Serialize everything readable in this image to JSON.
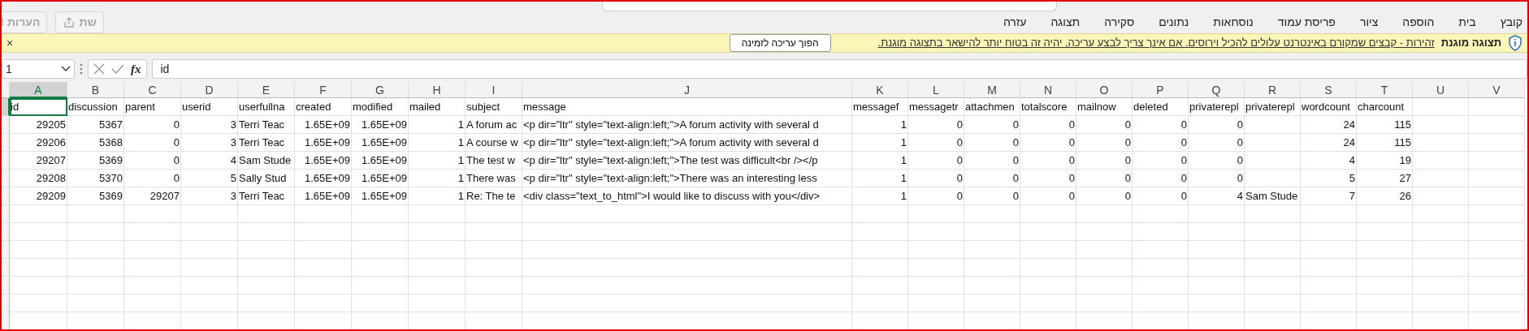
{
  "ribbon": {
    "tabs": [
      {
        "label": "קובץ",
        "selected": false
      },
      {
        "label": "בית",
        "selected": false
      },
      {
        "label": "הוספה",
        "selected": false
      },
      {
        "label": "ציור",
        "selected": false
      },
      {
        "label": "פריסת עמוד",
        "selected": false
      },
      {
        "label": "נוסחאות",
        "selected": false
      },
      {
        "label": "נתונים",
        "selected": false
      },
      {
        "label": "סקירה",
        "selected": false
      },
      {
        "label": "תצוגה",
        "selected": false
      },
      {
        "label": "עזרה",
        "selected": false
      }
    ],
    "buttons": [
      {
        "kind": "share",
        "label": "שת",
        "disabled": true
      },
      {
        "kind": "comments",
        "label": "הערות",
        "disabled": true
      }
    ]
  },
  "protected_view": {
    "title": "תצוגה מוגנת",
    "message": "זהירות - קבצים שמקורם באינטרנט עלולים להכיל וירוסים. אם אינך צריך לבצע עריכה, יהיה זה בטוח יותר להישאר בתצוגה מוגנת.",
    "button": "הפוך עריכה לזמינה",
    "close": "×"
  },
  "formula_bar": {
    "name_box": "1",
    "function_label": "fx",
    "formula": "id"
  },
  "sheet": {
    "columns": [
      {
        "letter": "A",
        "kind": "number",
        "selected": true
      },
      {
        "letter": "B",
        "kind": "number",
        "selected": false
      },
      {
        "letter": "C",
        "kind": "number",
        "selected": false
      },
      {
        "letter": "D",
        "kind": "number",
        "selected": false
      },
      {
        "letter": "E",
        "kind": "text",
        "selected": false
      },
      {
        "letter": "F",
        "kind": "number",
        "selected": false
      },
      {
        "letter": "G",
        "kind": "number",
        "selected": false
      },
      {
        "letter": "H",
        "kind": "number",
        "selected": false
      },
      {
        "letter": "I",
        "kind": "text",
        "selected": false
      },
      {
        "letter": "J",
        "kind": "text",
        "selected": false
      },
      {
        "letter": "K",
        "kind": "number",
        "selected": false
      },
      {
        "letter": "L",
        "kind": "number",
        "selected": false
      },
      {
        "letter": "M",
        "kind": "number",
        "selected": false
      },
      {
        "letter": "N",
        "kind": "number",
        "selected": false
      },
      {
        "letter": "O",
        "kind": "number",
        "selected": false
      },
      {
        "letter": "P",
        "kind": "number",
        "selected": false
      },
      {
        "letter": "Q",
        "kind": "number",
        "selected": false
      },
      {
        "letter": "R",
        "kind": "text",
        "selected": false
      },
      {
        "letter": "S",
        "kind": "number",
        "selected": false
      },
      {
        "letter": "T",
        "kind": "number",
        "selected": false
      },
      {
        "letter": "U",
        "kind": "text",
        "selected": false
      },
      {
        "letter": "V",
        "kind": "text",
        "selected": false
      }
    ],
    "rows": [
      {
        "kind": "header",
        "cells": [
          "id",
          "discussion",
          "parent",
          "userid",
          "userfullna",
          "created",
          "modified",
          "mailed",
          "subject",
          "message",
          "messagef",
          "messagetr",
          "attachmen",
          "totalscore",
          "mailnow",
          "deleted",
          "privaterepl",
          "privaterepl",
          "wordcount",
          "charcount",
          "",
          ""
        ],
        "selected": true
      },
      {
        "kind": "record",
        "selected": false,
        "cells": [
          "29205",
          "5367",
          "0",
          "3",
          "Terri Teac",
          "1.65E+09",
          "1.65E+09",
          "1",
          "A forum ac",
          "<p dir=\"ltr\" style=\"text-align:left;\">A forum activity with several d",
          "1",
          "0",
          "0",
          "0",
          "0",
          "0",
          "0",
          "",
          "24",
          "115",
          "",
          ""
        ]
      },
      {
        "kind": "record",
        "selected": false,
        "cells": [
          "29206",
          "5368",
          "0",
          "3",
          "Terri Teac",
          "1.65E+09",
          "1.65E+09",
          "1",
          "A course w",
          "<p dir=\"ltr\" style=\"text-align:left;\">A forum activity with several d",
          "1",
          "0",
          "0",
          "0",
          "0",
          "0",
          "0",
          "",
          "24",
          "115",
          "",
          ""
        ]
      },
      {
        "kind": "record",
        "selected": false,
        "cells": [
          "29207",
          "5369",
          "0",
          "4",
          "Sam Stude",
          "1.65E+09",
          "1.65E+09",
          "1",
          "The test w",
          "<p dir=\"ltr\" style=\"text-align:left;\">The test was difficult<br /></p",
          "1",
          "0",
          "0",
          "0",
          "0",
          "0",
          "0",
          "",
          "4",
          "19",
          "",
          ""
        ]
      },
      {
        "kind": "record",
        "selected": false,
        "cells": [
          "29208",
          "5370",
          "0",
          "5",
          "Sally Stud",
          "1.65E+09",
          "1.65E+09",
          "1",
          "There was",
          "<p dir=\"ltr\" style=\"text-align:left;\">There was an interesting less",
          "1",
          "0",
          "0",
          "0",
          "0",
          "0",
          "0",
          "",
          "5",
          "27",
          "",
          ""
        ]
      },
      {
        "kind": "record",
        "selected": false,
        "cells": [
          "29209",
          "5369",
          "29207",
          "3",
          "Terri Teac",
          "1.65E+09",
          "1.65E+09",
          "1",
          "Re: The te",
          "<div class=\"text_to_html\">I would like to discuss with you</div>",
          "1",
          "0",
          "0",
          "0",
          "0",
          "0",
          "4",
          "Sam Stude",
          "7",
          "26",
          "",
          ""
        ]
      }
    ]
  }
}
